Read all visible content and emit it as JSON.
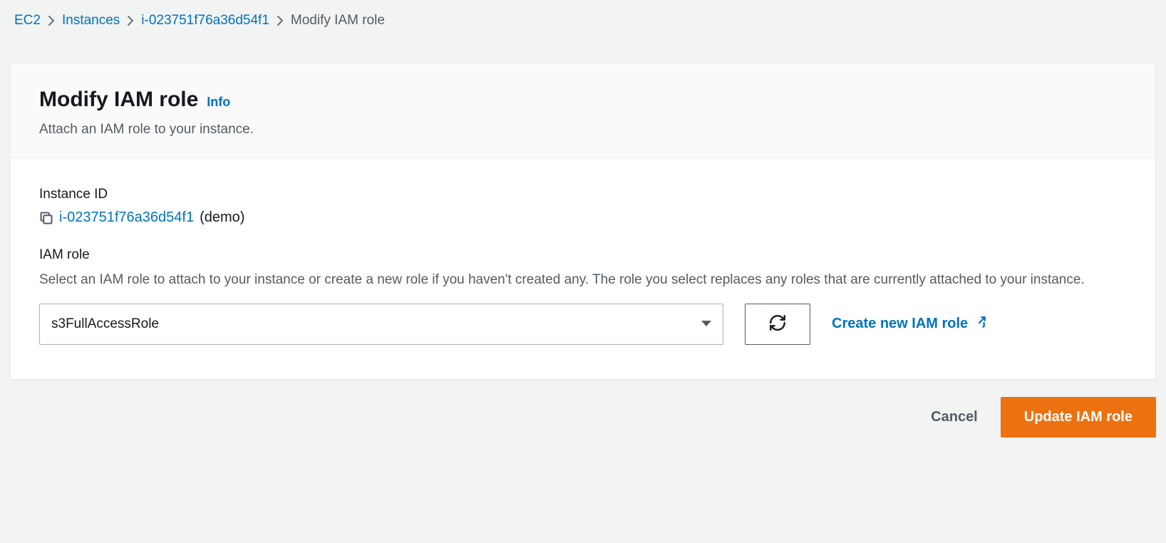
{
  "breadcrumb": {
    "items": [
      {
        "label": "EC2"
      },
      {
        "label": "Instances"
      },
      {
        "label": "i-023751f76a36d54f1"
      }
    ],
    "current": "Modify IAM role"
  },
  "header": {
    "title": "Modify IAM role",
    "info_label": "Info",
    "subtitle": "Attach an IAM role to your instance."
  },
  "instance": {
    "label": "Instance ID",
    "id": "i-023751f76a36d54f1",
    "name": "(demo)"
  },
  "iam_role": {
    "label": "IAM role",
    "description": "Select an IAM role to attach to your instance or create a new role if you haven't created any. The role you select replaces any roles that are currently attached to your instance.",
    "selected": "s3FullAccessRole",
    "create_link": "Create new IAM role"
  },
  "actions": {
    "cancel": "Cancel",
    "update": "Update IAM role"
  }
}
